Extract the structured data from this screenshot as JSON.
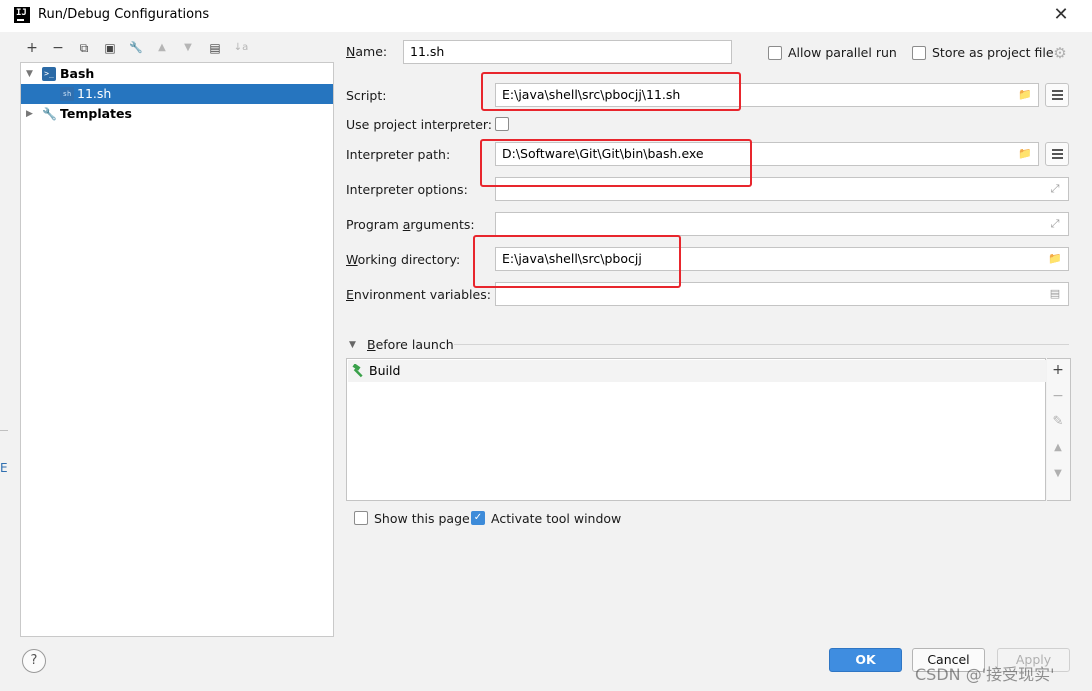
{
  "window": {
    "title": "Run/Debug Configurations",
    "app_icon_text": "IJ"
  },
  "toolbar": {
    "add": "+",
    "remove": "−",
    "copy": "⧉",
    "save": "▣",
    "edit_templates": "🔧",
    "move_up": "▲",
    "move_down": "▼",
    "new_folder": "▤",
    "sort": "↓a"
  },
  "tree": {
    "group_label": "Bash",
    "group_icon": ">_",
    "config_label": "11.sh",
    "templates_label": "Templates"
  },
  "form": {
    "name_label": "Name:",
    "name_value": "11.sh",
    "allow_parallel_label": "Allow parallel run",
    "store_as_project_label": "Store as project file",
    "script_label": "Script:",
    "script_value": "E:\\java\\shell\\src\\pbocjj\\11.sh",
    "use_interpreter_label": "Use project interpreter:",
    "interpreter_path_label": "Interpreter path:",
    "interpreter_path_value": "D:\\Software\\Git\\Git\\bin\\bash.exe",
    "interpreter_options_label": "Interpreter options:",
    "interpreter_options_value": "",
    "program_arguments_label": "Program arguments:",
    "program_arguments_value": "",
    "working_directory_label": "Working directory:",
    "working_directory_value": "E:\\java\\shell\\src\\pbocjj",
    "env_vars_label": "Environment variables:",
    "env_vars_value": ""
  },
  "before_launch": {
    "section_label": "Before launch",
    "items": [
      {
        "label": "Build"
      }
    ],
    "tools": {
      "add": "+",
      "remove": "−",
      "edit": "✎",
      "up": "▲",
      "down": "▼"
    }
  },
  "options": {
    "show_this_page_label": "Show this page",
    "show_this_page_checked": false,
    "activate_tool_window_label": "Activate tool window",
    "activate_tool_window_checked": true
  },
  "buttons": {
    "ok": "OK",
    "cancel": "Cancel",
    "apply": "Apply",
    "help": "?"
  },
  "edge": {
    "letter": "E"
  },
  "watermark": "CSDN @'接受现实'",
  "colors": {
    "selection": "#2675bf",
    "ok_button": "#3f8de0",
    "highlight": "#e8262d"
  }
}
